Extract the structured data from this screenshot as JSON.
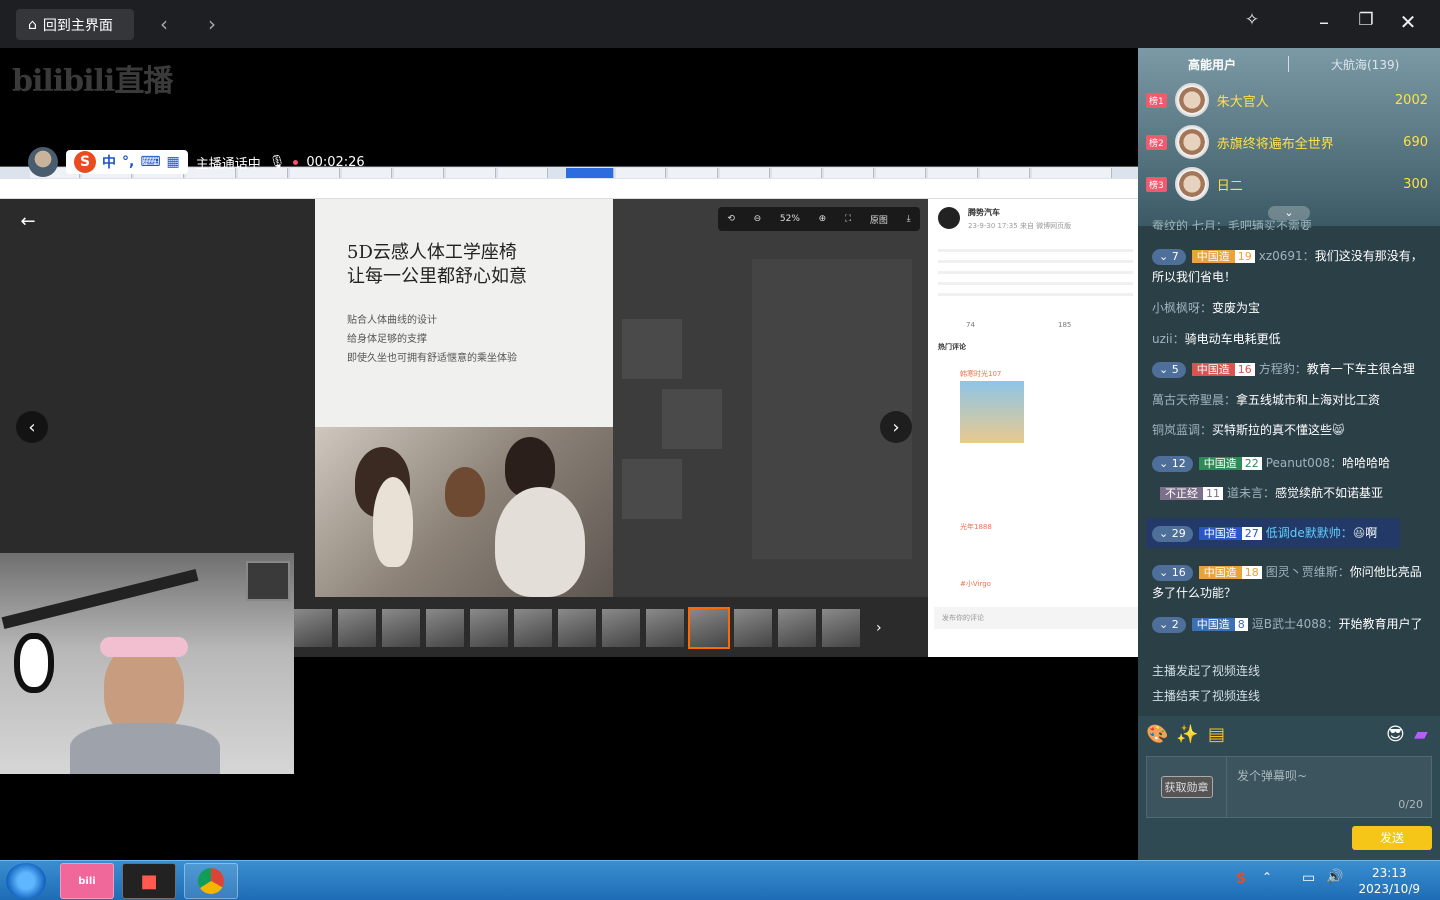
{
  "titlebar": {
    "home_label": "回到主界面"
  },
  "stage": {
    "logo": "bilibili直播",
    "call_status": "主播通话中",
    "call_timer": "00:02:26",
    "ime": {
      "s": "S",
      "mode": "中",
      "punct": "°,"
    }
  },
  "ad": {
    "title_line1": "5D云感人体工学座椅",
    "title_line2": "让每一公里都舒心如意",
    "sub1": "贴合人体曲线的设计",
    "sub2": "给身体足够的支撑",
    "sub3": "即使久坐也可拥有舒适惬意的乘坐体验"
  },
  "viewer": {
    "zoom": "52%",
    "original": "原图"
  },
  "weibo": {
    "account": "腾势汽车",
    "time": "23-9-30 17:35 来自 微博网页版",
    "hot_comments": "热门评论",
    "repost_count": "74",
    "comment_count": "185",
    "commenter1": "韩寒时光107",
    "commenter2": "光年1888",
    "commenter3": "#小Virgo",
    "post_comment": "发布你的评论"
  },
  "rank": {
    "tab_active": "高能用户",
    "tab_other": "大航海(139)",
    "rows": [
      {
        "badge": "榜1",
        "name": "朱大官人",
        "value": "2002"
      },
      {
        "badge": "榜2",
        "name": "赤旗终将遍布全世界",
        "value": "690"
      },
      {
        "badge": "榜3",
        "name": "日二",
        "value": "300"
      }
    ]
  },
  "chat": {
    "partial_top": "蚕纹的 七月：毛吧辆买不需要",
    "m1": {
      "level": "7",
      "medal": "中国造",
      "medal_level": "19",
      "user": "xz0691",
      "text": "我们这没有那没有，所以我们省电！"
    },
    "m2": {
      "user": "小枫枫呀",
      "text": "变废为宝"
    },
    "m3": {
      "user": "uzii",
      "text": "骑电动车电耗更低"
    },
    "m4": {
      "level": "5",
      "medal": "中国造",
      "medal_level": "16",
      "user": "方程豹",
      "text": "教育一下车主很合理"
    },
    "m5": {
      "user": "萬古天帝聖晨",
      "text": "拿五线城市和上海对比工资"
    },
    "m6": {
      "user": "铜岚蓝调",
      "text": "买特斯拉的真不懂这些"
    },
    "m7": {
      "level": "12",
      "medal": "中国造",
      "medal_level": "22",
      "user": "Peanut008",
      "text": "哈哈哈哈"
    },
    "m8": {
      "medal": "不正经",
      "medal_level": "11",
      "user": "道未言",
      "text": "感觉续航不如诺基亚"
    },
    "m9": {
      "level": "29",
      "medal": "中国造",
      "medal_level": "27",
      "user": "低调de默默帅",
      "text": "啊"
    },
    "m10": {
      "level": "16",
      "medal": "中国造",
      "medal_level": "18",
      "user": "图灵丶贾维斯",
      "text": "你问他比亮品多了什么功能？"
    },
    "m11": {
      "level": "2",
      "medal": "中国造",
      "medal_level": "8",
      "user": "逗B武士4088",
      "text": "开始教育用户了"
    },
    "sys1": "主播发起了视频连线",
    "sys2": "主播结束了视频连线"
  },
  "input": {
    "medal_btn": "获取勋章",
    "placeholder": "发个弹幕呗~",
    "counter": "0/20",
    "send": "发送"
  },
  "taskbar": {
    "time": "23:13",
    "date": "2023/10/9"
  },
  "colors": {
    "accent_yellow": "#f5c518",
    "rank_gold": "#ffe04a",
    "medal_orange": "#e8a33a"
  }
}
